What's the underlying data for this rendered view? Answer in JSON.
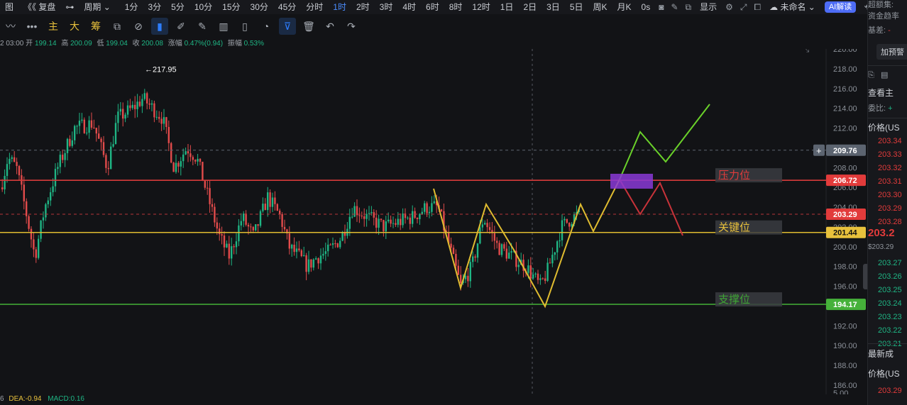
{
  "toolbar": {
    "left_items": [
      "图",
      "《《 复盘",
      "⊶",
      "周期 ⌄"
    ],
    "periods": [
      "1分",
      "3分",
      "5分",
      "10分",
      "15分",
      "30分",
      "45分",
      "分时",
      "1时",
      "2时",
      "3时",
      "4时",
      "6时",
      "8时",
      "12时",
      "1日",
      "2日",
      "3日",
      "5日",
      "周K",
      "月K"
    ],
    "active_period": "1时",
    "right_items": [
      "0s"
    ],
    "display_label": "显示",
    "cloud_label": "未命名",
    "ai_label": "AI解读"
  },
  "drawing_toolbar": {
    "more": "•••",
    "indicators": [
      "主",
      "大",
      "筹"
    ]
  },
  "infobar": {
    "time": "2 03:00",
    "open_label": "开",
    "open": "199.14",
    "high_label": "高",
    "high": "200.09",
    "low_label": "低",
    "low": "199.04",
    "close_label": "收",
    "close": "200.08",
    "change_label": "涨幅",
    "change": "0.47%(0.94)",
    "amp_label": "振幅",
    "amp": "0.53%"
  },
  "chart_data": {
    "type": "candlestick",
    "y_axis_ticks": [
      "220.00",
      "218.00",
      "216.00",
      "214.00",
      "212.00",
      "210.00",
      "208.00",
      "206.00",
      "204.00",
      "202.00",
      "200.00",
      "198.00",
      "196.00",
      "194.00",
      "192.00",
      "190.00",
      "188.00",
      "186.00"
    ],
    "ylim": [
      185,
      221
    ],
    "high_marker": "217.95",
    "price_tags": [
      {
        "value": "209.76",
        "color": "#5c6470",
        "dashed": true,
        "line_color": "#5c6470"
      },
      {
        "value": "206.72",
        "color": "#e23b3b",
        "dashed": false,
        "line_color": "#d63a3a"
      },
      {
        "value": "203.29",
        "color": "#e23b3b",
        "dashed": true,
        "line_color": "#b8363a"
      },
      {
        "value": "201.44",
        "color": "#e8c13c",
        "dashed": false,
        "line_color": "#e0bc30"
      },
      {
        "value": "194.17",
        "color": "#46b13a",
        "dashed": false,
        "line_color": "#3fa435"
      }
    ],
    "level_labels": [
      {
        "text": "压力位",
        "price": 206.72,
        "color": "#e23b3b"
      },
      {
        "text": "关键位",
        "price": 201.44,
        "color": "#e8c13c"
      },
      {
        "text": "支撑位",
        "price": 194.17,
        "color": "#3fa435"
      }
    ],
    "zigzag_yellow": [
      [
        611,
        266
      ],
      [
        649,
        406
      ],
      [
        685,
        288
      ],
      [
        725,
        354
      ],
      [
        768,
        432
      ],
      [
        818,
        288
      ],
      [
        836,
        326
      ],
      [
        873,
        253
      ]
    ],
    "projection_green": [
      [
        873,
        253
      ],
      [
        902,
        186
      ],
      [
        938,
        228
      ],
      [
        1000,
        147
      ]
    ],
    "projection_red": [
      [
        873,
        253
      ],
      [
        902,
        302
      ],
      [
        930,
        258
      ],
      [
        962,
        332
      ]
    ],
    "highlight_box": {
      "color": "#8a3ad6"
    },
    "bottom_label": "5.00"
  },
  "macd": {
    "prefix": "6",
    "dea_label": "DEA:",
    "dea": "-0.94",
    "macd_label": "MACD:",
    "macd": "0.16"
  },
  "sidebar": {
    "head1": "超额集:",
    "head2": "资金趋率",
    "head3": "基差:",
    "add_alert": "加预警",
    "view_main": "查看主",
    "ratio_label": "委比:",
    "price_header": "价格(US",
    "asks": [
      "203.34",
      "203.33",
      "203.32",
      "203.31",
      "203.30",
      "203.29",
      "203.28"
    ],
    "last_price": "203.2",
    "last_sub": "$203.29",
    "bids": [
      "203.27",
      "203.26",
      "203.25",
      "203.24",
      "203.23",
      "203.22",
      "203.21"
    ],
    "latest_trades": "最新成",
    "price_header2": "价格(US",
    "trade_price": "203.29",
    "up_color": "#e23b3b",
    "down_color": "#1fb584"
  }
}
